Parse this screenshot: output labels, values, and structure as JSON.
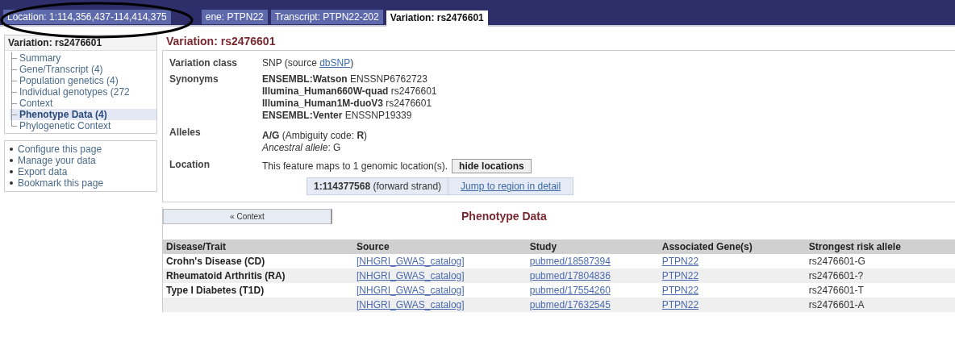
{
  "tabs": [
    {
      "label": "Location: 1:114,356,437-114,414,375",
      "selected": false
    },
    {
      "label": "ene: PTPN22",
      "selected": false
    },
    {
      "label": "Transcript: PTPN22-202",
      "selected": false
    },
    {
      "label": "Variation: rs2476601",
      "selected": true
    }
  ],
  "sidebar": {
    "title": "Variation: rs2476601",
    "items": [
      {
        "label": "Summary",
        "selected": false
      },
      {
        "label": "Gene/Transcript (4)",
        "selected": false
      },
      {
        "label": "Population genetics (4)",
        "selected": false
      },
      {
        "label": "Individual genotypes (272",
        "selected": false
      },
      {
        "label": "Context",
        "selected": false
      },
      {
        "label": "Phenotype Data (4)",
        "selected": true
      },
      {
        "label": "Phylogenetic Context",
        "selected": false
      }
    ],
    "actions": [
      "Configure this page",
      "Manage your data",
      "Export data",
      "Bookmark this page"
    ]
  },
  "main": {
    "title": "Variation: rs2476601",
    "fields": [
      {
        "kind": "source",
        "label": "Variation class",
        "before": "SNP (source ",
        "link": "dbSNP",
        "after": ")"
      },
      {
        "kind": "lines",
        "label": "Synonyms",
        "lines": [
          "**ENSEMBL:Watson** ENSSNP6762723",
          "**Illumina_Human660W-quad** rs2476601",
          "**Illumina_Human1M-duoV3** rs2476601",
          "**ENSEMBL:Venter** ENSSNP19339"
        ]
      },
      {
        "kind": "lines",
        "label": "Alleles",
        "lines": [
          "**A/G** (Ambiguity code: **R**)",
          "*Ancestral allele*: G"
        ]
      },
      {
        "kind": "location",
        "label": "Location",
        "text": "This feature maps to 1 genomic location(s).",
        "button": "hide locations",
        "position": "**1:114377568** (forward strand)",
        "link": "Jump to region in detail"
      }
    ]
  },
  "phenotype": {
    "context_button": "« Context",
    "title": "Phenotype Data",
    "table": {
      "columns": [
        "Disease/Trait",
        "Source",
        "Study",
        "Associated Gene(s)",
        "Strongest risk allele"
      ],
      "rows": [
        [
          "Crohn's Disease (CD)",
          "[NHGRI_GWAS_catalog]",
          "pubmed/18587394",
          "PTPN22",
          "rs2476601-G"
        ],
        [
          "Rheumatoid Arthritis (RA)",
          "[NHGRI_GWAS_catalog]",
          "pubmed/17804836",
          "PTPN22",
          "rs2476601-?"
        ],
        [
          "Type I Diabetes (T1D)",
          "[NHGRI_GWAS_catalog]",
          "pubmed/17554260",
          "PTPN22",
          "rs2476601-T"
        ],
        [
          "",
          "[NHGRI_GWAS_catalog]",
          "pubmed/17632545",
          "PTPN22",
          "rs2476601-A"
        ]
      ]
    }
  }
}
